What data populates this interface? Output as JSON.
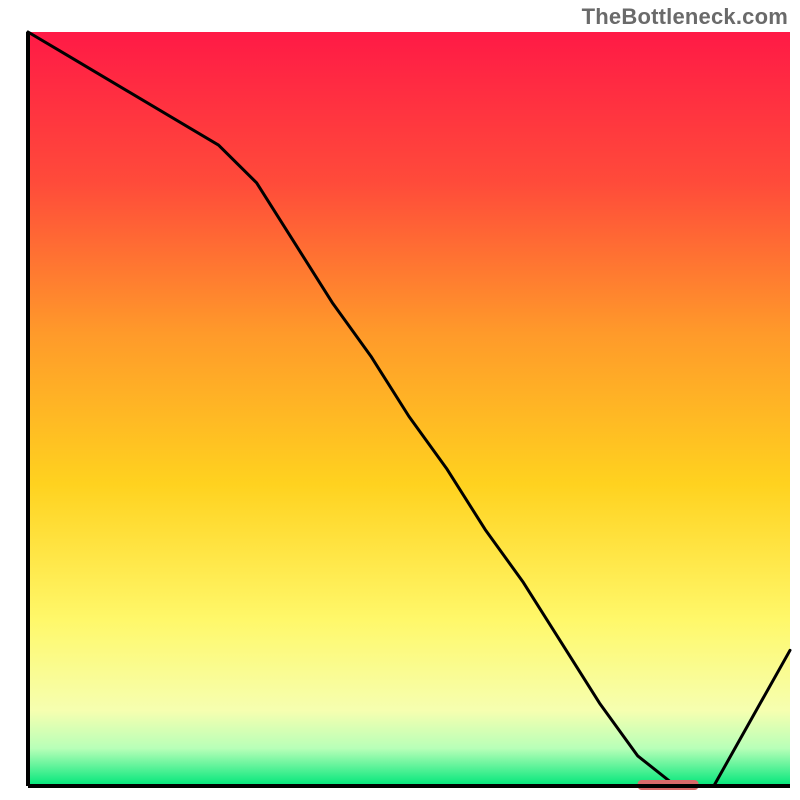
{
  "watermark": "TheBottleneck.com",
  "chart_data": {
    "type": "line",
    "title": "",
    "xlabel": "",
    "ylabel": "",
    "xlim": [
      0,
      100
    ],
    "ylim": [
      0,
      100
    ],
    "x": [
      0,
      5,
      25,
      30,
      35,
      40,
      45,
      50,
      55,
      60,
      65,
      70,
      75,
      80,
      85,
      90,
      95,
      100
    ],
    "values": [
      100,
      97,
      85,
      80,
      72,
      64,
      57,
      49,
      42,
      34,
      27,
      19,
      11,
      4,
      0,
      0,
      9,
      18
    ],
    "optimal_marker": {
      "x_start": 80,
      "x_end": 88,
      "y": 0
    },
    "gradient_stops": [
      {
        "offset": 0.0,
        "color": "#ff1a46"
      },
      {
        "offset": 0.2,
        "color": "#ff4b3a"
      },
      {
        "offset": 0.4,
        "color": "#ff9a2a"
      },
      {
        "offset": 0.6,
        "color": "#ffd21f"
      },
      {
        "offset": 0.78,
        "color": "#fff86a"
      },
      {
        "offset": 0.9,
        "color": "#f6ffb0"
      },
      {
        "offset": 0.95,
        "color": "#b8ffb8"
      },
      {
        "offset": 1.0,
        "color": "#00e67a"
      }
    ],
    "axes": {
      "show_ticks": false,
      "show_grid": false,
      "frame": true
    }
  }
}
